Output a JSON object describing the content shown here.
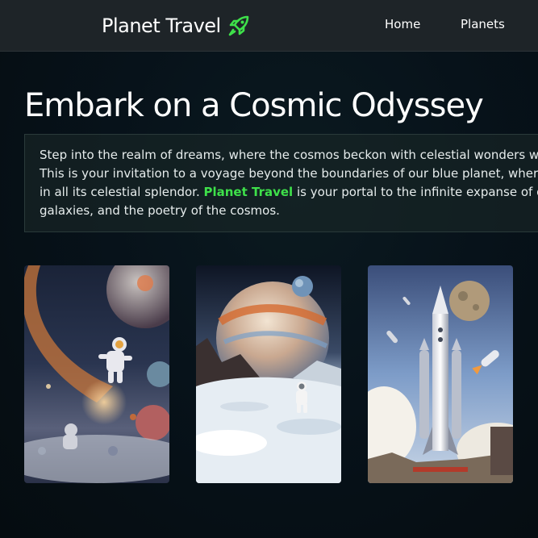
{
  "navbar": {
    "brand": "Planet Travel",
    "brand_icon": "rocket-icon",
    "brand_icon_color": "#3ee04a",
    "links": [
      "Home",
      "Planets"
    ]
  },
  "hero": {
    "title": "Embark on a Cosmic Odyssey",
    "intro": {
      "line1": "Step into the realm of dreams, where the cosmos beckon with celestial wonders wait",
      "line2": "This is your invitation to a voyage beyond the boundaries of our blue planet, where th",
      "line3_before": "in all its celestial splendor. ",
      "line3_highlight": "Planet Travel",
      "line3_after": " is your portal to the infinite expanse of outer",
      "line4": "galaxies, and the poetry of the cosmos."
    },
    "highlight_color": "#3ee04a"
  },
  "gallery": {
    "images": [
      {
        "subject": "astronaut floating in space among planets"
      },
      {
        "subject": "astronaut on icy planet surface with ringed planet"
      },
      {
        "subject": "rocket launch with spaceships and planet"
      }
    ]
  }
}
